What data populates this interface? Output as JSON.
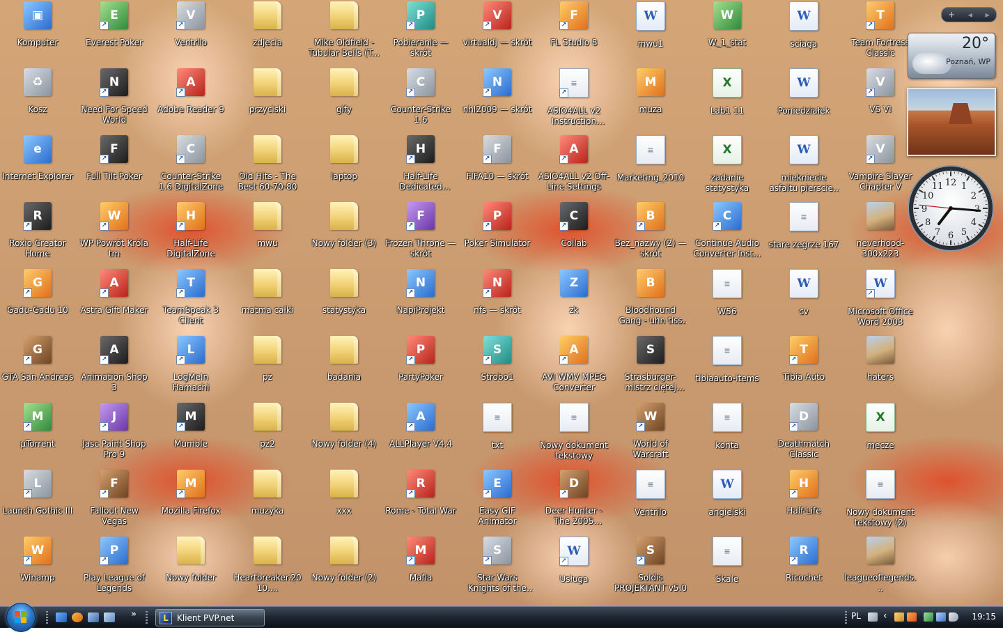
{
  "desktop": {
    "columns": [
      [
        {
          "label": "Komputer",
          "type": "computer",
          "shortcut": false
        },
        {
          "label": "Kosz",
          "type": "recycle",
          "shortcut": false
        },
        {
          "label": "Internet Explorer",
          "type": "ie",
          "shortcut": false
        },
        {
          "label": "Roxio Creator Home",
          "type": "app-dark",
          "shortcut": true
        },
        {
          "label": "Gadu-Gadu 10",
          "type": "app-orange",
          "shortcut": true
        },
        {
          "label": "GTA San Andreas",
          "type": "app-brown",
          "shortcut": true
        },
        {
          "label": "µTorrent",
          "type": "app-green",
          "shortcut": true
        },
        {
          "label": "Launch Gothic III",
          "type": "app-gray",
          "shortcut": true
        },
        {
          "label": "Winamp",
          "type": "app-orange",
          "shortcut": true
        }
      ],
      [
        {
          "label": "Everest Poker",
          "type": "app-green",
          "shortcut": true
        },
        {
          "label": "Need For Speed World",
          "type": "app-dark",
          "shortcut": true
        },
        {
          "label": "Full Tilt Poker",
          "type": "app-dark",
          "shortcut": true
        },
        {
          "label": "WP Powrót Króla tm",
          "type": "app-orange",
          "shortcut": true
        },
        {
          "label": "Astra Gift Maker",
          "type": "app-red",
          "shortcut": true
        },
        {
          "label": "Animation Shop 3",
          "type": "app-dark",
          "shortcut": true
        },
        {
          "label": "Jasc Paint Shop Pro 9",
          "type": "app-purple",
          "shortcut": true
        },
        {
          "label": "Fallout New Vegas",
          "type": "app-brown",
          "shortcut": true
        },
        {
          "label": "Play League of Legends",
          "type": "app-blue",
          "shortcut": true
        }
      ],
      [
        {
          "label": "Ventrilo",
          "type": "app-gray",
          "shortcut": true
        },
        {
          "label": "Adobe Reader 9",
          "type": "app-red",
          "shortcut": true
        },
        {
          "label": "Counter-Strike 1.6 DigitalZone",
          "type": "app-gray",
          "shortcut": true
        },
        {
          "label": "Half-Life DigitalZone",
          "type": "app-orange",
          "shortcut": true
        },
        {
          "label": "TeamSpeak 3 Client",
          "type": "app-blue",
          "shortcut": true
        },
        {
          "label": "LogMeIn Hamachi",
          "type": "app-blue",
          "shortcut": true
        },
        {
          "label": "Mumble",
          "type": "app-dark",
          "shortcut": true
        },
        {
          "label": "Mozilla Firefox",
          "type": "app-orange",
          "shortcut": true
        },
        {
          "label": "Nowy folder",
          "type": "folder",
          "shortcut": false
        }
      ],
      [
        {
          "label": "zdjecia",
          "type": "folder",
          "shortcut": false
        },
        {
          "label": "przyciski",
          "type": "folder",
          "shortcut": false
        },
        {
          "label": "Old Hits - The Best 60-70-80",
          "type": "folder",
          "shortcut": false
        },
        {
          "label": "mwu",
          "type": "folder",
          "shortcut": false
        },
        {
          "label": "matma całki",
          "type": "folder",
          "shortcut": false
        },
        {
          "label": "pz",
          "type": "folder",
          "shortcut": false
        },
        {
          "label": "pz2",
          "type": "folder",
          "shortcut": false
        },
        {
          "label": "muzyka",
          "type": "folder",
          "shortcut": false
        },
        {
          "label": "Heartbreaker.2010....",
          "type": "folder",
          "shortcut": false
        }
      ],
      [
        {
          "label": "Mike Oldfield - Tubular Bells (T...",
          "type": "folder",
          "shortcut": false
        },
        {
          "label": "gify",
          "type": "folder",
          "shortcut": false
        },
        {
          "label": "laptop",
          "type": "folder",
          "shortcut": false
        },
        {
          "label": "Nowy folder (3)",
          "type": "folder",
          "shortcut": false
        },
        {
          "label": "statystyka",
          "type": "folder",
          "shortcut": false
        },
        {
          "label": "badania",
          "type": "folder",
          "shortcut": false
        },
        {
          "label": "Nowy folder (4)",
          "type": "folder",
          "shortcut": false
        },
        {
          "label": "xxx",
          "type": "folder",
          "shortcut": false
        },
        {
          "label": "Nowy folder (2)",
          "type": "folder",
          "shortcut": false
        }
      ],
      [
        {
          "label": "Pobieranie — skrót",
          "type": "app-teal",
          "shortcut": true
        },
        {
          "label": "Counter-Strike 1.6",
          "type": "app-gray",
          "shortcut": true
        },
        {
          "label": "Half-Life Dedicated Server",
          "type": "app-dark",
          "shortcut": true
        },
        {
          "label": "Frozen Throne — skrót",
          "type": "app-purple",
          "shortcut": true
        },
        {
          "label": "NapiProjekt",
          "type": "app-blue",
          "shortcut": true
        },
        {
          "label": "PartyPoker",
          "type": "app-red",
          "shortcut": true
        },
        {
          "label": "ALLPlayer V4.4",
          "type": "app-blue",
          "shortcut": true
        },
        {
          "label": "Rome - Total War",
          "type": "app-red",
          "shortcut": true
        },
        {
          "label": "Mafia",
          "type": "app-red",
          "shortcut": true
        }
      ],
      [
        {
          "label": "virtualdj — skrót",
          "type": "app-red",
          "shortcut": true
        },
        {
          "label": "nhl2009 — skrót",
          "type": "app-blue",
          "shortcut": true
        },
        {
          "label": "FIFA10 — skrót",
          "type": "app-gray",
          "shortcut": true
        },
        {
          "label": "Poker Simulator",
          "type": "app-red",
          "shortcut": true
        },
        {
          "label": "nfs — skrót",
          "type": "app-red",
          "shortcut": true
        },
        {
          "label": "Strobo1",
          "type": "app-teal",
          "shortcut": true
        },
        {
          "label": "txt",
          "type": "doc",
          "shortcut": false
        },
        {
          "label": "Easy GIF Animator",
          "type": "app-blue",
          "shortcut": true
        },
        {
          "label": "Star Wars Knights of the Old Republic",
          "type": "app-gray",
          "shortcut": true
        }
      ],
      [
        {
          "label": "FL Studio 8",
          "type": "app-orange",
          "shortcut": true
        },
        {
          "label": "ASIO4ALL v2 Instruction Manual",
          "type": "doc",
          "shortcut": true
        },
        {
          "label": "ASIO4ALL v2 Off-Line Settings",
          "type": "app-red",
          "shortcut": true
        },
        {
          "label": "Collab",
          "type": "app-dark",
          "shortcut": true
        },
        {
          "label": "zk",
          "type": "app-blue",
          "shortcut": false
        },
        {
          "label": "AVI WMV MPEG Converter",
          "type": "app-orange",
          "shortcut": true
        },
        {
          "label": "Nowy dokument tekstowy",
          "type": "doc",
          "shortcut": false
        },
        {
          "label": "Deer Hunter - The 2005 Season",
          "type": "app-brown",
          "shortcut": true
        },
        {
          "label": "Usługa",
          "type": "word",
          "shortcut": true
        }
      ],
      [
        {
          "label": "mwu1",
          "type": "word",
          "shortcut": false
        },
        {
          "label": "muza",
          "type": "app-orange",
          "shortcut": false
        },
        {
          "label": "Marketing_2010",
          "type": "doc",
          "shortcut": false
        },
        {
          "label": "Bez_nazwy (2) — skrót",
          "type": "app-orange",
          "shortcut": true
        },
        {
          "label": "Bloodhound Gang - uhn tiss uhn tiss u...",
          "type": "app-orange",
          "shortcut": false
        },
        {
          "label": "Strasburger-mistrz ciętej riposty.mp4",
          "type": "app-dark",
          "shortcut": false
        },
        {
          "label": "World of Warcraft",
          "type": "app-brown",
          "shortcut": true
        },
        {
          "label": "Ventrilo",
          "type": "doc",
          "shortcut": false
        },
        {
          "label": "Soldis PROJEKTANT v5.0",
          "type": "app-brown",
          "shortcut": true
        }
      ],
      [
        {
          "label": "W_1_stat",
          "type": "app-green",
          "shortcut": false
        },
        {
          "label": "Lab1 11",
          "type": "excel",
          "shortcut": false
        },
        {
          "label": "zadanie statystyka",
          "type": "excel",
          "shortcut": false
        },
        {
          "label": "Continue Audio Converter Inst...",
          "type": "app-blue",
          "shortcut": true
        },
        {
          "label": "W56",
          "type": "doc",
          "shortcut": false
        },
        {
          "label": "tibiaauto-items",
          "type": "doc",
          "shortcut": false
        },
        {
          "label": "konta",
          "type": "doc",
          "shortcut": false
        },
        {
          "label": "angielski",
          "type": "word",
          "shortcut": false
        },
        {
          "label": "Skale",
          "type": "doc",
          "shortcut": false
        }
      ],
      [
        {
          "label": "sciaga",
          "type": "word",
          "shortcut": false
        },
        {
          "label": "Poniedziałek",
          "type": "word",
          "shortcut": false
        },
        {
          "label": "miekniecie asfaltu pierscien i kula",
          "type": "word",
          "shortcut": false
        },
        {
          "label": "stare zegrze 167",
          "type": "doc",
          "shortcut": false
        },
        {
          "label": "cv",
          "type": "word",
          "shortcut": false
        },
        {
          "label": "Tibia Auto",
          "type": "app-orange",
          "shortcut": true
        },
        {
          "label": "Deathmatch Classic",
          "type": "app-gray",
          "shortcut": true
        },
        {
          "label": "Half-Life",
          "type": "app-orange",
          "shortcut": true
        },
        {
          "label": "Ricochet",
          "type": "app-blue",
          "shortcut": true
        }
      ],
      [
        {
          "label": "Team Fortress Classic",
          "type": "app-orange",
          "shortcut": true
        },
        {
          "label": "VS VI",
          "type": "app-gray",
          "shortcut": true
        },
        {
          "label": "Vampire Slayer Chapter V",
          "type": "app-gray",
          "shortcut": true
        },
        {
          "label": "neverhood-300x223",
          "type": "photo",
          "shortcut": false
        },
        {
          "label": "Microsoft Office Word 2003",
          "type": "word",
          "shortcut": true
        },
        {
          "label": "haters",
          "type": "photo",
          "shortcut": false
        },
        {
          "label": "mecze",
          "type": "excel",
          "shortcut": false
        },
        {
          "label": "Nowy dokument tekstowy (2)",
          "type": "doc",
          "shortcut": false
        },
        {
          "label": "leagueoflegends...",
          "type": "photo",
          "shortcut": false
        }
      ]
    ]
  },
  "sidebar": {
    "toolbar": {
      "add_label": "+",
      "prev_label": "◀",
      "next_label": "▶"
    },
    "weather": {
      "temperature": "20°",
      "location": "Poznań, WP"
    },
    "slideshow": {
      "icon": "slideshow-photo"
    },
    "clock": {
      "hour": 7,
      "minute": 15,
      "second": 46
    }
  },
  "taskbar": {
    "start_icon": "windows-start-orb",
    "quicklaunch": [
      "show-desktop-icon",
      "media-player-icon",
      "switch-windows-icon",
      "explorer-icon"
    ],
    "overflow_label": "»",
    "task": {
      "label": "Klient PVP.net",
      "icon_letter": "L"
    },
    "tray": {
      "language": "PL",
      "time": "19:15",
      "chevron": "‹"
    }
  },
  "colors": {
    "taskbar": "#1a222c",
    "text_shadow": "#000000",
    "skin_highlight": "#fad5b6",
    "shirt_red": "#e14b28"
  }
}
